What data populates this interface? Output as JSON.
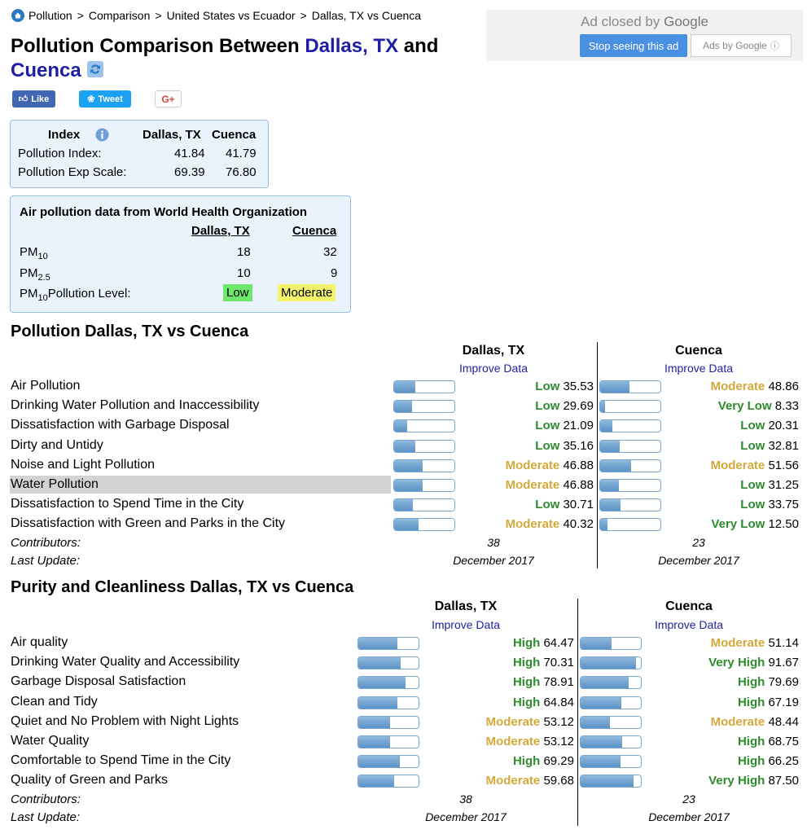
{
  "breadcrumb": [
    "Pollution",
    "Comparison",
    "United States vs Ecuador",
    "Dallas, TX vs Cuenca"
  ],
  "title": {
    "prefix": "Pollution Comparison Between ",
    "city1": "Dallas, TX",
    "middle": " and ",
    "city2": "Cuenca"
  },
  "social": {
    "like": "Like",
    "tweet": "Tweet",
    "gplus": "G+"
  },
  "ad": {
    "closed_by": "Ad closed by ",
    "google": "Google",
    "stop": "Stop seeing this ad",
    "ads_by": "Ads by Google"
  },
  "index_box": {
    "header": "Index",
    "city1": "Dallas, TX",
    "city2": "Cuenca",
    "rows": [
      {
        "label": "Pollution Index:",
        "v1": "41.84",
        "v2": "41.79"
      },
      {
        "label": "Pollution Exp Scale:",
        "v1": "69.39",
        "v2": "76.80"
      }
    ]
  },
  "who_box": {
    "title": "Air pollution data from World Health Organization",
    "city1": "Dallas, TX",
    "city2": "Cuenca",
    "pm10_label": "PM",
    "pm10_sub": "10",
    "pm25_label": "PM",
    "pm25_sub": "2.5",
    "pm10_v1": "18",
    "pm10_v2": "32",
    "pm25_v1": "10",
    "pm25_v2": "9",
    "level_label_pre": "PM",
    "level_label_sub": "10",
    "level_label_post": "Pollution Level:",
    "level1": "Low",
    "level2": "Moderate"
  },
  "pollution": {
    "title": "Pollution Dallas, TX vs Cuenca",
    "city1": "Dallas, TX",
    "city2": "Cuenca",
    "improve": "Improve Data",
    "rows": [
      {
        "label": "Air Pollution",
        "l1": "Low",
        "v1": "35.53",
        "f1": 0.3553,
        "l2": "Moderate",
        "v2": "48.86",
        "f2": 0.4886
      },
      {
        "label": "Drinking Water Pollution and Inaccessibility",
        "l1": "Low",
        "v1": "29.69",
        "f1": 0.2969,
        "l2": "Very Low",
        "v2": "8.33",
        "f2": 0.0833
      },
      {
        "label": "Dissatisfaction with Garbage Disposal",
        "l1": "Low",
        "v1": "21.09",
        "f1": 0.2109,
        "l2": "Low",
        "v2": "20.31",
        "f2": 0.2031
      },
      {
        "label": "Dirty and Untidy",
        "l1": "Low",
        "v1": "35.16",
        "f1": 0.3516,
        "l2": "Low",
        "v2": "32.81",
        "f2": 0.3281
      },
      {
        "label": "Noise and Light Pollution",
        "l1": "Moderate",
        "v1": "46.88",
        "f1": 0.4688,
        "l2": "Moderate",
        "v2": "51.56",
        "f2": 0.5156
      },
      {
        "label": "Water Pollution",
        "l1": "Moderate",
        "v1": "46.88",
        "f1": 0.4688,
        "l2": "Low",
        "v2": "31.25",
        "f2": 0.3125
      },
      {
        "label": "Dissatisfaction to Spend Time in the City",
        "l1": "Low",
        "v1": "30.71",
        "f1": 0.3071,
        "l2": "Low",
        "v2": "33.75",
        "f2": 0.3375
      },
      {
        "label": "Dissatisfaction with Green and Parks in the City",
        "l1": "Moderate",
        "v1": "40.32",
        "f1": 0.4032,
        "l2": "Very Low",
        "v2": "12.50",
        "f2": 0.125
      }
    ],
    "contributors_label": "Contributors:",
    "contributors1": "38",
    "contributors2": "23",
    "update_label": "Last Update:",
    "update1": "December 2017",
    "update2": "December 2017"
  },
  "purity": {
    "title": "Purity and Cleanliness Dallas, TX vs Cuenca",
    "city1": "Dallas, TX",
    "city2": "Cuenca",
    "improve": "Improve Data",
    "rows": [
      {
        "label": "Air quality",
        "l1": "High",
        "v1": "64.47",
        "f1": 0.6447,
        "l2": "Moderate",
        "v2": "51.14",
        "f2": 0.5114
      },
      {
        "label": "Drinking Water Quality and Accessibility",
        "l1": "High",
        "v1": "70.31",
        "f1": 0.7031,
        "l2": "Very High",
        "v2": "91.67",
        "f2": 0.9167
      },
      {
        "label": "Garbage Disposal Satisfaction",
        "l1": "High",
        "v1": "78.91",
        "f1": 0.7891,
        "l2": "High",
        "v2": "79.69",
        "f2": 0.7969
      },
      {
        "label": "Clean and Tidy",
        "l1": "High",
        "v1": "64.84",
        "f1": 0.6484,
        "l2": "High",
        "v2": "67.19",
        "f2": 0.6719
      },
      {
        "label": "Quiet and No Problem with Night Lights",
        "l1": "Moderate",
        "v1": "53.12",
        "f1": 0.5312,
        "l2": "Moderate",
        "v2": "48.44",
        "f2": 0.4844
      },
      {
        "label": "Water Quality",
        "l1": "Moderate",
        "v1": "53.12",
        "f1": 0.5312,
        "l2": "High",
        "v2": "68.75",
        "f2": 0.6875
      },
      {
        "label": "Comfortable to Spend Time in the City",
        "l1": "High",
        "v1": "69.29",
        "f1": 0.6929,
        "l2": "High",
        "v2": "66.25",
        "f2": 0.6625
      },
      {
        "label": "Quality of Green and Parks",
        "l1": "Moderate",
        "v1": "59.68",
        "f1": 0.5968,
        "l2": "Very High",
        "v2": "87.50",
        "f2": 0.875
      }
    ],
    "contributors_label": "Contributors:",
    "contributors1": "38",
    "contributors2": "23",
    "update_label": "Last Update:",
    "update1": "December 2017",
    "update2": "December 2017"
  },
  "colors": {
    "good": "#2e8b2e",
    "moderate": "#d4a83a",
    "link": "#1f1fa3",
    "bar": "#5b93c6"
  },
  "highlighted_row": "Water Pollution"
}
